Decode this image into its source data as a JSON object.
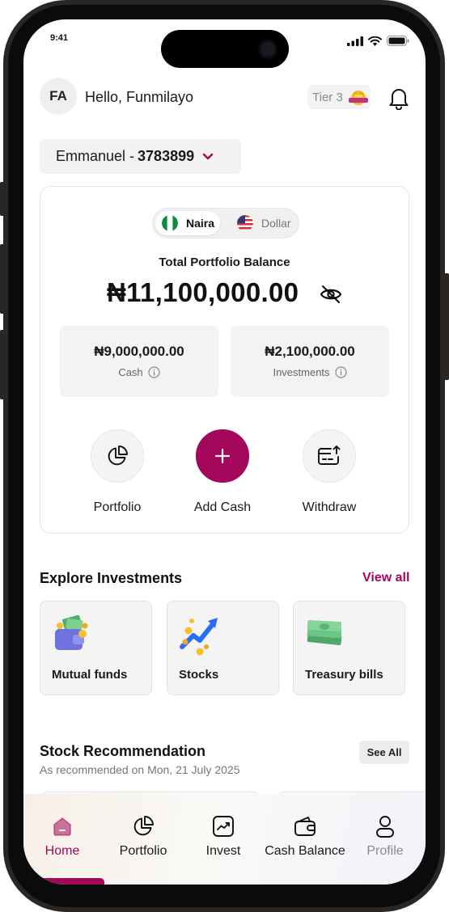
{
  "status_bar": {
    "time": "9:41"
  },
  "header": {
    "avatar_initials": "FA",
    "greeting": "Hello, Funmilayo",
    "tier": "Tier 3"
  },
  "account": {
    "name": "Emmanuel - ",
    "number": "3783899"
  },
  "currency_toggle": {
    "naira": "Naira",
    "dollar": "Dollar",
    "selected": "Naira"
  },
  "portfolio": {
    "title": "Total Portfolio Balance",
    "balance": "₦11,100,000.00",
    "cash_amount": "₦9,000,000.00",
    "cash_label": "Cash",
    "investments_amount": "₦2,100,000.00",
    "investments_label": "Investments"
  },
  "actions": {
    "portfolio": "Portfolio",
    "add_cash": "Add Cash",
    "withdraw": "Withdraw"
  },
  "explore": {
    "title": "Explore Investments",
    "view_all": "View all",
    "items": [
      {
        "label": "Mutual funds",
        "icon": "wallet-money-icon"
      },
      {
        "label": "Stocks",
        "icon": "stocks-arrow-icon"
      },
      {
        "label": "Treasury bills",
        "icon": "cash-stack-icon"
      }
    ]
  },
  "stocks": {
    "title": "Stock Recommendation",
    "subtitle": "As recommended on Mon, 21 July 2025",
    "see_all": "See All"
  },
  "bottom_nav": {
    "items": [
      {
        "label": "Home",
        "icon": "home-icon",
        "active": true
      },
      {
        "label": "Portfolio",
        "icon": "pie-chart-icon"
      },
      {
        "label": "Invest",
        "icon": "trend-chart-icon"
      },
      {
        "label": "Cash Balance",
        "icon": "wallet-icon"
      },
      {
        "label": "Profile",
        "icon": "user-icon"
      }
    ]
  },
  "colors": {
    "accent": "#a3085a",
    "card_bg": "#f3f3f3",
    "border": "#e4e4e4"
  }
}
